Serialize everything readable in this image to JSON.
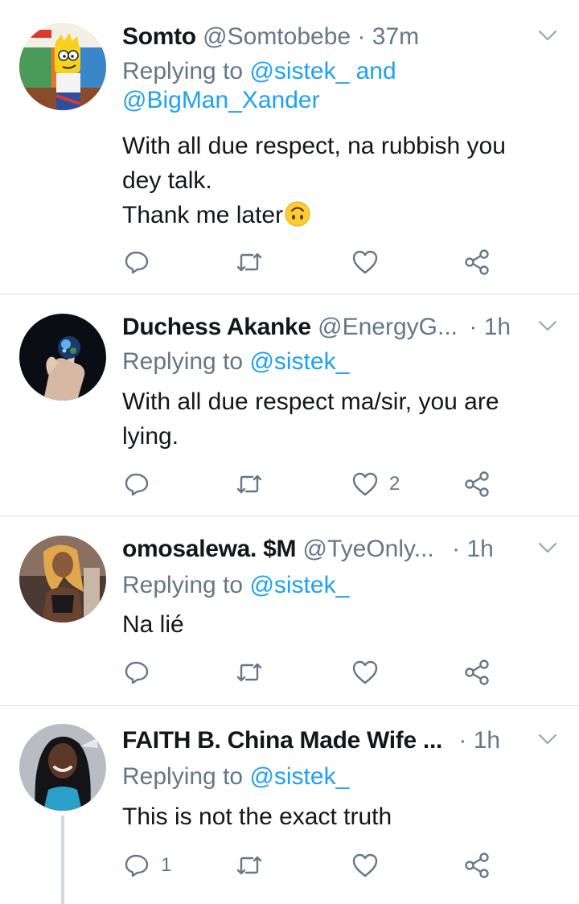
{
  "tweets": [
    {
      "name": "Somto",
      "handle": "@Somtobebe",
      "dot": "·",
      "time": "37m",
      "reply_prefix": "Replying to",
      "reply_to_line1": "@sistek_ and",
      "reply_to_line2": "@BigMan_Xander",
      "body_lines": [
        "With all due respect, na rubbish you",
        "dey talk.",
        "Thank me later"
      ],
      "emoji": "upside-down-face",
      "reply_count": "",
      "retweet_count": "",
      "like_count": ""
    },
    {
      "name": "Duchess Akanke",
      "handle": "@EnergyG...",
      "dot": "·",
      "time": "1h",
      "reply_prefix": "Replying to",
      "reply_to_line1": "@sistek_",
      "body_lines": [
        "With all due respect ma/sir, you are",
        "lying."
      ],
      "reply_count": "",
      "retweet_count": "",
      "like_count": "2"
    },
    {
      "name": "omosalewa. $M",
      "handle": "@TyeOnly...",
      "dot": "·",
      "time": "1h",
      "reply_prefix": "Replying to",
      "reply_to_line1": "@sistek_",
      "body_lines": [
        "Na lié"
      ],
      "reply_count": "",
      "retweet_count": "",
      "like_count": ""
    },
    {
      "name": "FAITH B. China Made Wife ...",
      "handle": "",
      "dot": "·",
      "time": "1h",
      "reply_prefix": "Replying to",
      "reply_to_line1": "@sistek_",
      "body_lines": [
        "This is not the exact truth"
      ],
      "reply_count": "1",
      "retweet_count": "",
      "like_count": ""
    }
  ],
  "colors": {
    "text": "#14171a",
    "muted": "#657786",
    "link": "#1da1f2",
    "divider": "#d9dde1"
  },
  "icons": [
    "reply-icon",
    "retweet-icon",
    "like-icon",
    "share-icon",
    "chevron-down-icon"
  ]
}
